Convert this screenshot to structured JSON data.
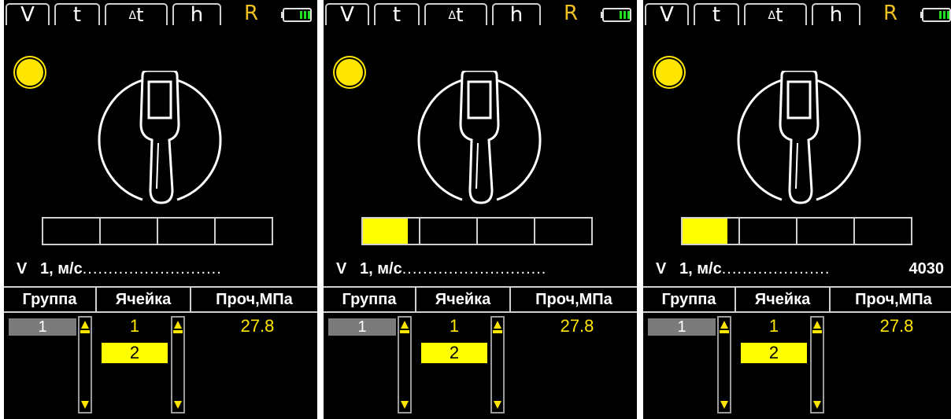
{
  "tabs": [
    "V",
    "t",
    "Δt",
    "h",
    "R"
  ],
  "active_tab": "R",
  "table_headers": {
    "group": "Группа",
    "cell": "Ячейка",
    "strength": "Проч,МПа"
  },
  "panels": [
    {
      "progress_fraction": 0.0,
      "reading": {
        "label": "V",
        "value": "1, м/с",
        "dots": "...........................",
        "result": ""
      },
      "group": "1",
      "cell_current": "1",
      "cell_next": "2",
      "strength": "27.8"
    },
    {
      "progress_fraction": 0.2,
      "reading": {
        "label": "V",
        "value": "1, м/с",
        "dots": "............................",
        "result": ""
      },
      "group": "1",
      "cell_current": "1",
      "cell_next": "2",
      "strength": "27.8"
    },
    {
      "progress_fraction": 0.2,
      "reading": {
        "label": "V",
        "value": "1, м/с",
        "dots": ".....................",
        "result": "4030"
      },
      "group": "1",
      "cell_current": "1",
      "cell_next": "2",
      "strength": "27.8"
    }
  ],
  "icons": {
    "battery": "battery-full-icon",
    "led": "led-indicator-icon",
    "device": "ultrasonic-probe-icon"
  },
  "colors": {
    "accent": "#ffe600",
    "fill": "#ffff00",
    "background": "#000000",
    "group_bg": "#7b7b7b"
  }
}
